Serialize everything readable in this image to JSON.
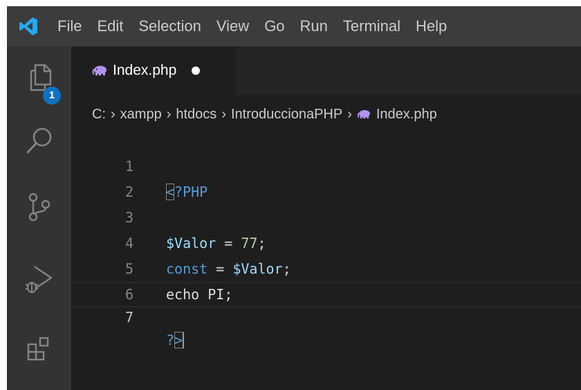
{
  "menubar": {
    "logo_icon": "vscode-logo-icon",
    "items": [
      "File",
      "Edit",
      "Selection",
      "View",
      "Go",
      "Run",
      "Terminal",
      "Help"
    ]
  },
  "activitybar": {
    "items": [
      {
        "icon": "explorer-icon",
        "badge": "1"
      },
      {
        "icon": "search-icon"
      },
      {
        "icon": "source-control-icon"
      },
      {
        "icon": "run-debug-icon"
      },
      {
        "icon": "extensions-icon"
      }
    ]
  },
  "tab": {
    "icon": "php-elephant-icon",
    "label": "Index.php",
    "unsaved": true
  },
  "breadcrumb": {
    "parts": [
      "C:",
      "xampp",
      "htdocs",
      "IntroduccionaPHP",
      "Index.php"
    ]
  },
  "editor": {
    "line_numbers": [
      "1",
      "2",
      "3",
      "4",
      "5",
      "6",
      "7"
    ],
    "current_line": "7",
    "lines": {
      "l1_open_bracket": "<",
      "l1_rest": "?PHP",
      "l3_var": "$Valor",
      "l3_eq": " = ",
      "l3_num": "77",
      "l3_end": ";",
      "l4_kw": "const",
      "l4_eq": " = ",
      "l4_var": "$Valor",
      "l4_end": ";",
      "l5_text": "echo PI;",
      "l7_q": "?",
      "l7_close_bracket": ">"
    }
  },
  "colors": {
    "menubar_bg": "#3c3c3c",
    "activitybar_bg": "#333333",
    "editor_bg": "#1e1e1e",
    "badge_bg": "#0e70c0",
    "keyword": "#569cd6",
    "variable": "#9cdcfe",
    "number": "#b5cea8"
  }
}
